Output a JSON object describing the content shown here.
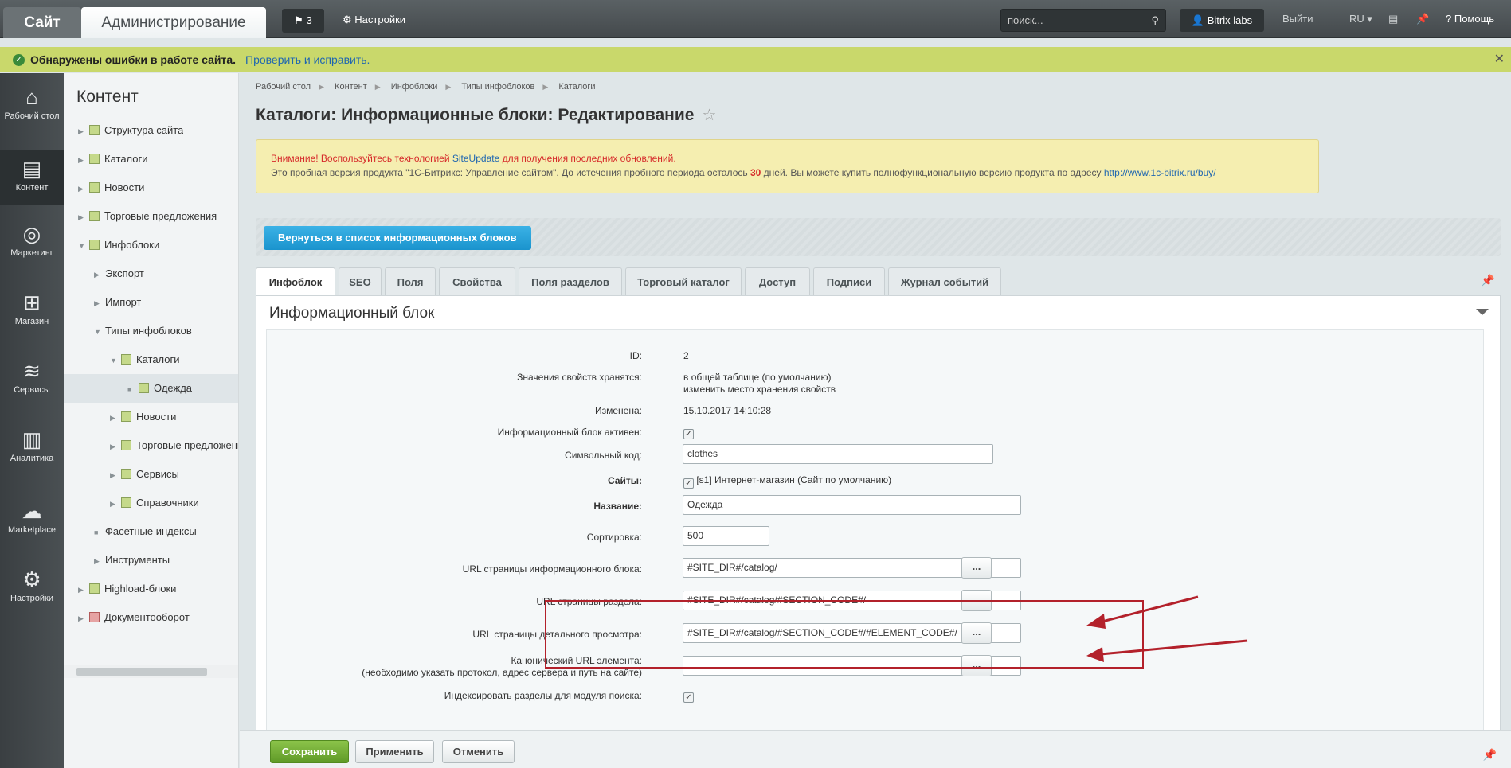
{
  "topbar": {
    "site_tab": "Сайт",
    "admin_tab": "Администрирование",
    "notifications_count": "3",
    "settings_label": "Настройки",
    "search_placeholder": "поиск...",
    "user_label": "Bitrix labs",
    "logout_label": "Выйти",
    "lang_label": "RU",
    "help_label": "Помощь"
  },
  "warning_bar": {
    "text": "Обнаружены ошибки в работе сайта.",
    "link": "Проверить и исправить."
  },
  "iconbar": [
    {
      "label": "Рабочий стол",
      "icon": "home-icon"
    },
    {
      "label": "Контент",
      "icon": "document-icon"
    },
    {
      "label": "Маркетинг",
      "icon": "target-icon"
    },
    {
      "label": "Магазин",
      "icon": "basket-icon"
    },
    {
      "label": "Сервисы",
      "icon": "layers-icon"
    },
    {
      "label": "Аналитика",
      "icon": "chart-icon"
    },
    {
      "label": "Marketplace",
      "icon": "cloud-download-icon"
    },
    {
      "label": "Настройки",
      "icon": "gear-icon"
    }
  ],
  "sidebar": {
    "title": "Контент",
    "items": [
      {
        "label": "Структура сайта"
      },
      {
        "label": "Каталоги"
      },
      {
        "label": "Новости"
      },
      {
        "label": "Торговые предложения"
      },
      {
        "label": "Инфоблоки"
      },
      {
        "label": "Экспорт"
      },
      {
        "label": "Импорт"
      },
      {
        "label": "Типы инфоблоков"
      },
      {
        "label": "Каталоги"
      },
      {
        "label": "Одежда"
      },
      {
        "label": "Новости"
      },
      {
        "label": "Торговые предложения"
      },
      {
        "label": "Сервисы"
      },
      {
        "label": "Справочники"
      },
      {
        "label": "Фасетные индексы"
      },
      {
        "label": "Инструменты"
      },
      {
        "label": "Highload-блоки"
      },
      {
        "label": "Документооборот"
      }
    ]
  },
  "breadcrumb": [
    "Рабочий стол",
    "Контент",
    "Инфоблоки",
    "Типы инфоблоков",
    "Каталоги"
  ],
  "page_title": "Каталоги: Информационные блоки: Редактирование",
  "notice": {
    "line1_a": "Внимание! Воспользуйтесь технологией ",
    "line1_link": "SiteUpdate",
    "line1_b": " для получения последних обновлений.",
    "line2_a": "Это пробная версия продукта \"1С-Битрикс: Управление сайтом\". До истечения пробного периода осталось ",
    "line2_days": "30",
    "line2_b": " дней. Вы можете купить полнофункциональную версию продукта по адресу ",
    "line2_link": "http://www.1c-bitrix.ru/buy/"
  },
  "back_button": "Вернуться в список информационных блоков",
  "tabs": [
    {
      "label": "Инфоблок"
    },
    {
      "label": "SEO"
    },
    {
      "label": "Поля"
    },
    {
      "label": "Свойства"
    },
    {
      "label": "Поля разделов"
    },
    {
      "label": "Торговый каталог"
    },
    {
      "label": "Доступ"
    },
    {
      "label": "Подписи"
    },
    {
      "label": "Журнал событий"
    }
  ],
  "panel_title": "Информационный блок",
  "form": {
    "id_label": "ID:",
    "id_value": "2",
    "storage_label": "Значения свойств хранятся:",
    "storage_value": "в общей таблице (по умолчанию)",
    "storage_link": "изменить место хранения свойств",
    "modified_label": "Изменена:",
    "modified_value": "15.10.2017 14:10:28",
    "active_label": "Информационный блок активен:",
    "code_label": "Символьный код:",
    "code_value": "clothes",
    "sites_label": "Сайты:",
    "sites_value": "[s1] Интернет-магазин (Сайт по умолчанию)",
    "name_label": "Название:",
    "name_value": "Одежда",
    "sort_label": "Сортировка:",
    "sort_value": "500",
    "list_url_label": "URL страницы информационного блока:",
    "list_url_value": "#SITE_DIR#/catalog/",
    "section_url_label": "URL страницы раздела:",
    "section_url_value": "#SITE_DIR#/catalog/#SECTION_CODE#/",
    "detail_url_label": "URL страницы детального просмотра:",
    "detail_url_value": "#SITE_DIR#/catalog/#SECTION_CODE#/#ELEMENT_CODE#/",
    "canonical_label_1": "Канонический URL элемента:",
    "canonical_label_2": "(необходимо указать протокол, адрес сервера и путь на сайте)",
    "canonical_value": "",
    "index_label": "Индексировать разделы для модуля поиска:",
    "dots": "..."
  },
  "buttons": {
    "save": "Сохранить",
    "apply": "Применить",
    "cancel": "Отменить"
  },
  "colors": {
    "accent_blue": "#1a93cd",
    "save_green": "#5f9a27",
    "warning_bar": "#c9d86b",
    "annotation_red": "#b3212b"
  }
}
